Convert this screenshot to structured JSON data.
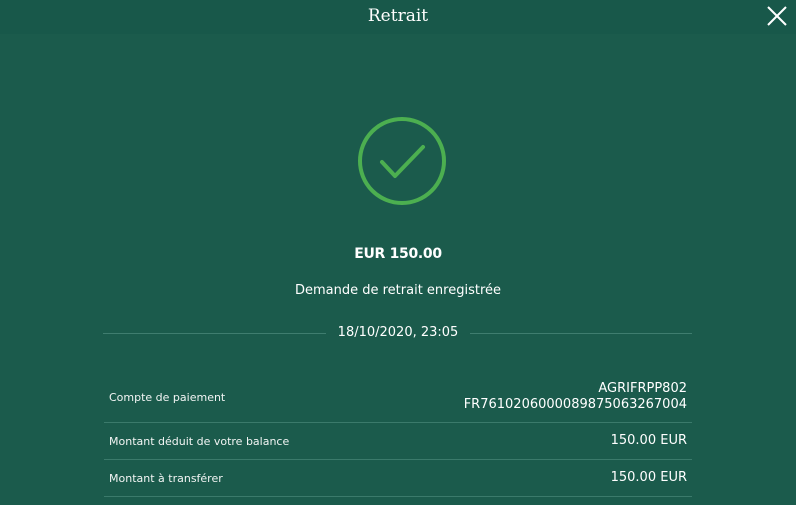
{
  "header": {
    "title": "Retrait",
    "close_icon": "close-icon"
  },
  "success": {
    "icon": "checkmark-circle-icon",
    "color": "#4caf50"
  },
  "amount": "EUR 150.00",
  "status": "Demande de retrait enregistrée",
  "date": "18/10/2020, 23:05",
  "details": [
    {
      "label": "Compte de paiement",
      "value_line1": "AGRIFRPP802",
      "value_line2": "FR7610206000089875063267004"
    },
    {
      "label": "Montant déduit de votre balance",
      "value_line1": "150.00 EUR"
    },
    {
      "label": "Montant à transférer",
      "value_line1": "150.00 EUR"
    }
  ],
  "colors": {
    "background": "#1b5b4c",
    "accent": "#4caf50"
  }
}
